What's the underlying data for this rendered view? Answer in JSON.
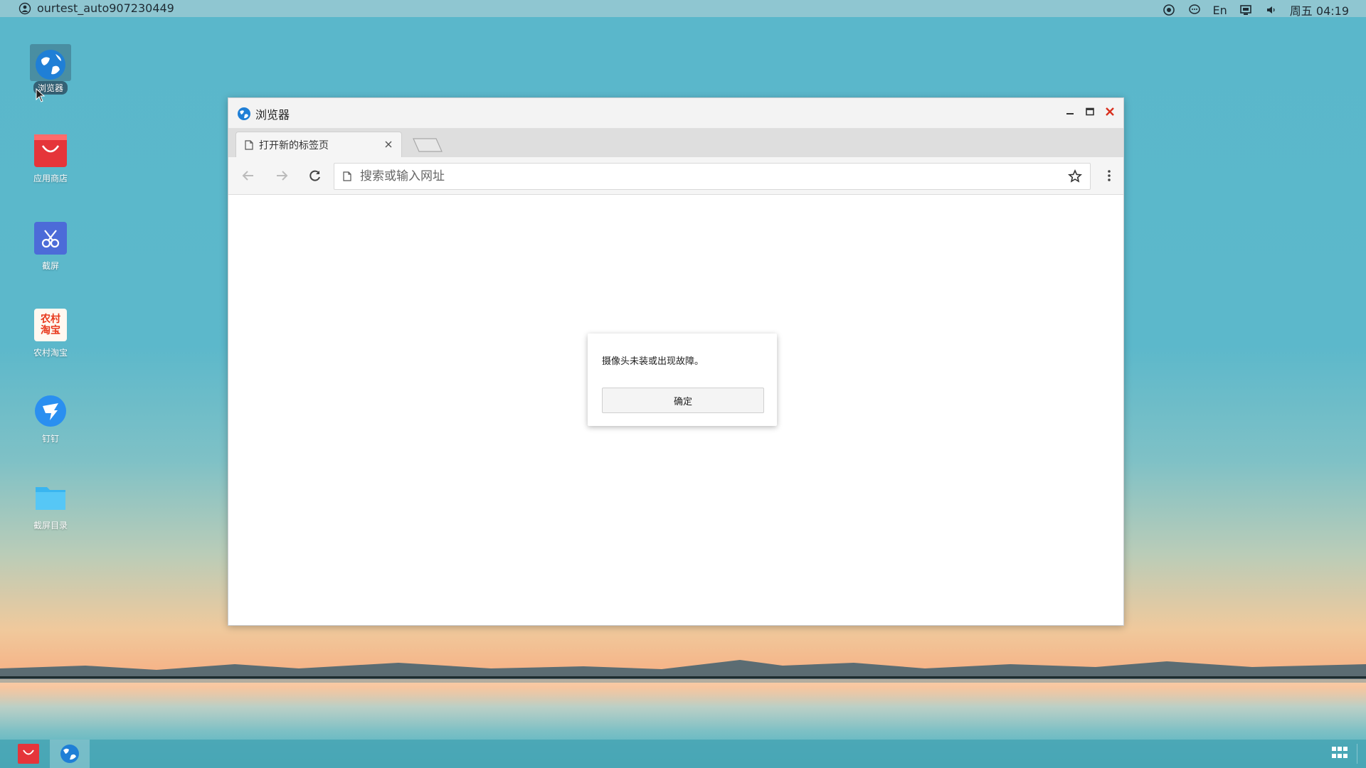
{
  "topbar": {
    "username": "ourtest_auto907230449",
    "input_method": "En",
    "clock": "周五 04:19"
  },
  "desktop": {
    "icons": [
      {
        "label": "浏览器",
        "icon": "browser-globe-icon"
      },
      {
        "label": "应用商店",
        "icon": "app-store-bag-icon"
      },
      {
        "label": "截屏",
        "icon": "scissors-icon"
      },
      {
        "label": "农村淘宝",
        "icon": "rural-taobao-icon",
        "text": "农村淘宝"
      },
      {
        "label": "钉钉",
        "icon": "dingtalk-icon"
      },
      {
        "label": "截屏目录",
        "icon": "folder-icon"
      }
    ]
  },
  "browser": {
    "window_title": "浏览器",
    "tab_title": "打开新的标签页",
    "address_placeholder": "搜索或输入网址"
  },
  "dialog": {
    "message": "摄像头未装或出现故障。",
    "ok_label": "确定"
  },
  "colors": {
    "close_red": "#d9301e",
    "accent_blue": "#2a7fd4",
    "store_red": "#e5353a"
  }
}
